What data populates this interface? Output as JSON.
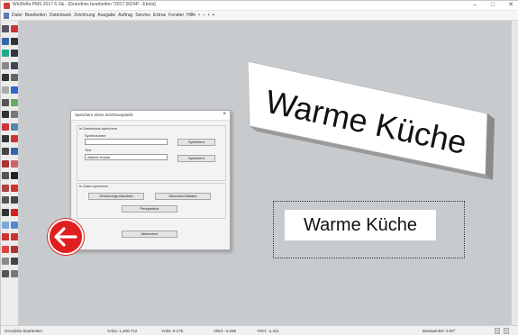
{
  "window": {
    "title": "WinDelta PMS 2017 6.X& - [Grundriss bearbeiten *2017.0024P - Ebola]",
    "controls": [
      "–",
      "□",
      "✕"
    ]
  },
  "menu": {
    "items": [
      "Datei",
      "Bearbeiten",
      "Datenbank",
      "Zeichnung",
      "Ausgabe",
      "Auftrag",
      "Service",
      "Extras",
      "Fenster",
      "Hilfe",
      "•",
      "–",
      "•",
      "+"
    ]
  },
  "canvas": {
    "sign_3d_text": "Warme Küche",
    "sign_flat_text": "Warme Küche"
  },
  "dialog": {
    "title": "Speichern eines Zeichnungsteils",
    "close": "×",
    "group_db": "In Datenbank speichern",
    "label_symbolname": "Symbolname",
    "symbolname_value": "",
    "save1": "Speichern",
    "label_text": "Text",
    "text_value": "Warme Küche",
    "save2": "Speichern",
    "group_file": "In Datei speichern",
    "btn_zeichnung": "Zeichnungs-Baustein",
    "btn_windows": "Windows-Bitdatei",
    "btn_perspektive": "Perspektive",
    "btn_abbrechen": "Abbrechen"
  },
  "status": {
    "mode": "Grundriss bearbeiten",
    "xabs": "XAbs: 1.200.712",
    "yabs": "YAbs: 9.176",
    "xrel": "XRel: -4.536",
    "yrel": "YRel: -1.411",
    "angle": "Basiswinkel: 0.00°"
  },
  "colors": {
    "accent_red": "#e02020",
    "canvas_bg": "#c8cbce"
  }
}
